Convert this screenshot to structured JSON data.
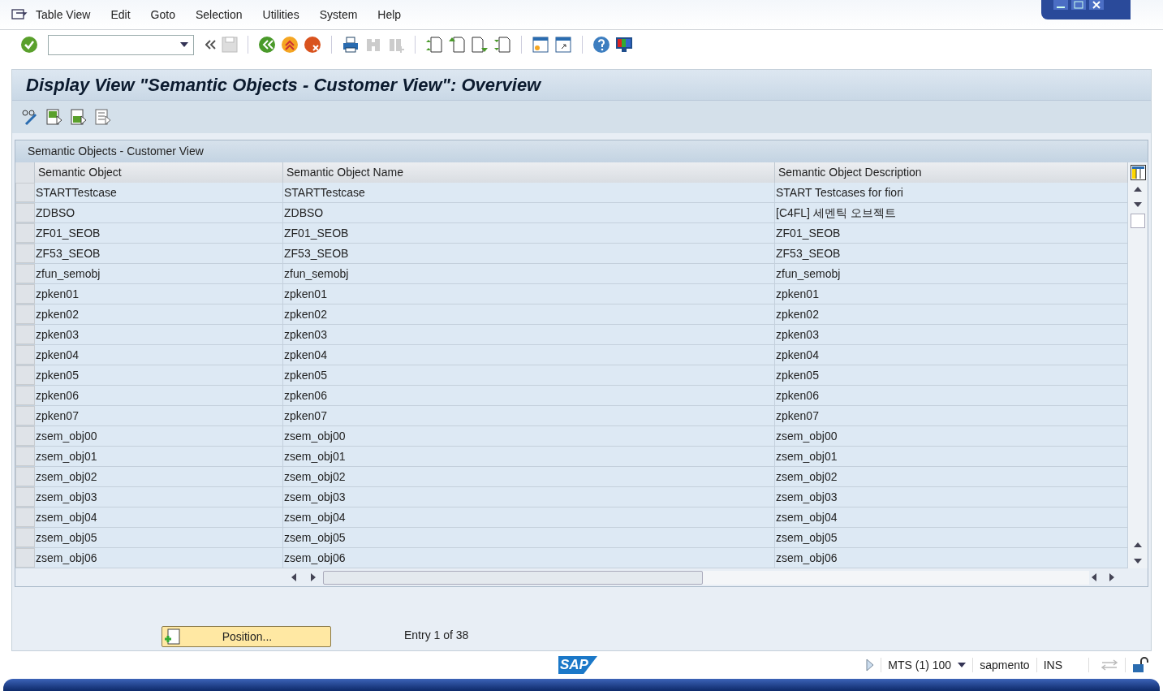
{
  "menu": [
    "Table View",
    "Edit",
    "Goto",
    "Selection",
    "Utilities",
    "System",
    "Help"
  ],
  "title": "Display View \"Semantic Objects - Customer View\": Overview",
  "table": {
    "caption": "Semantic Objects - Customer View",
    "columns": [
      "Semantic Object",
      "Semantic Object Name",
      "Semantic Object Description"
    ],
    "rows": [
      [
        "STARTTestcase",
        "STARTTestcase",
        "START Testcases for fiori"
      ],
      [
        "ZDBSO",
        "ZDBSO",
        "[C4FL] 세멘틱 오브젝트"
      ],
      [
        "ZF01_SEOB",
        "ZF01_SEOB",
        "ZF01_SEOB"
      ],
      [
        "ZF53_SEOB",
        "ZF53_SEOB",
        "ZF53_SEOB"
      ],
      [
        "zfun_semobj",
        "zfun_semobj",
        "zfun_semobj"
      ],
      [
        "zpken01",
        "zpken01",
        "zpken01"
      ],
      [
        "zpken02",
        "zpken02",
        "zpken02"
      ],
      [
        "zpken03",
        "zpken03",
        "zpken03"
      ],
      [
        "zpken04",
        "zpken04",
        "zpken04"
      ],
      [
        "zpken05",
        "zpken05",
        "zpken05"
      ],
      [
        "zpken06",
        "zpken06",
        "zpken06"
      ],
      [
        "zpken07",
        "zpken07",
        "zpken07"
      ],
      [
        "zsem_obj00",
        "zsem_obj00",
        "zsem_obj00"
      ],
      [
        "zsem_obj01",
        "zsem_obj01",
        "zsem_obj01"
      ],
      [
        "zsem_obj02",
        "zsem_obj02",
        "zsem_obj02"
      ],
      [
        "zsem_obj03",
        "zsem_obj03",
        "zsem_obj03"
      ],
      [
        "zsem_obj04",
        "zsem_obj04",
        "zsem_obj04"
      ],
      [
        "zsem_obj05",
        "zsem_obj05",
        "zsem_obj05"
      ],
      [
        "zsem_obj06",
        "zsem_obj06",
        "zsem_obj06"
      ]
    ]
  },
  "position_button": "Position...",
  "entry_info": "Entry 1 of 38",
  "logo": "SAP",
  "status_bar": {
    "system": "MTS (1) 100",
    "server": "sapmento",
    "mode": "INS"
  }
}
